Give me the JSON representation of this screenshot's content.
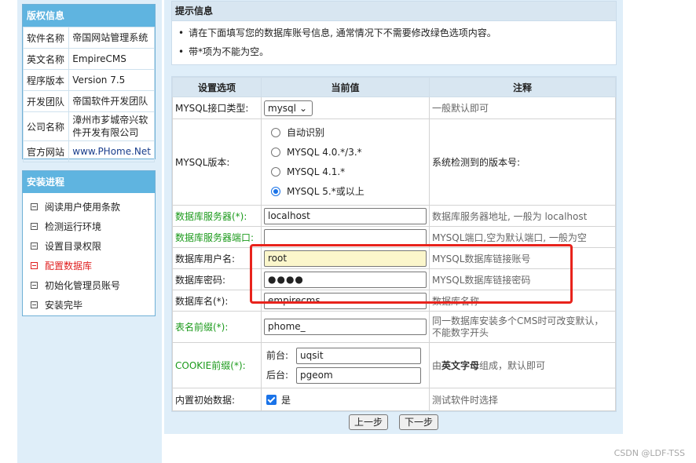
{
  "copyright": {
    "title": "版权信息",
    "rows": [
      {
        "key": "软件名称",
        "value": "帝国网站管理系统"
      },
      {
        "key": "英文名称",
        "value": "EmpireCMS"
      },
      {
        "key": "程序版本",
        "value": "Version 7.5"
      },
      {
        "key": "开发团队",
        "value": "帝国软件开发团队"
      },
      {
        "key": "公司名称",
        "value": "漳州市芗城帝兴软件开发有限公司"
      },
      {
        "key": "官方网站",
        "value": "www.PHome.Net"
      }
    ]
  },
  "progress": {
    "title": "安装进程",
    "steps": [
      "阅读用户使用条款",
      "检测运行环境",
      "设置目录权限",
      "配置数据库",
      "初始化管理员账号",
      "安装完毕"
    ],
    "active_index": 3
  },
  "tips": {
    "title": "提示信息",
    "items": [
      "请在下面填写您的数据库账号信息, 通常情况下不需要修改绿色选项内容。",
      "带*项为不能为空。"
    ]
  },
  "config": {
    "headers": [
      "设置选项",
      "当前值",
      "注释"
    ],
    "mysql_type": {
      "label": "MYSQL接口类型:",
      "value": "mysql",
      "note": "一般默认即可"
    },
    "mysql_version": {
      "label": "MYSQL版本:",
      "options": [
        "自动识别",
        "MYSQL 4.0.*/3.*",
        "MYSQL 4.1.*",
        "MYSQL 5.*或以上"
      ],
      "selected": 3,
      "note": "系统检测到的版本号:"
    },
    "db_server": {
      "label": "数据库服务器(*):",
      "value": "localhost",
      "note": "数据库服务器地址, 一般为 localhost"
    },
    "db_port": {
      "label": "数据库服务器端口:",
      "value": "",
      "note": "MYSQL端口,空为默认端口, 一般为空"
    },
    "db_user": {
      "label": "数据库用户名:",
      "value": "root",
      "note": "MYSQL数据库链接账号"
    },
    "db_pass": {
      "label": "数据库密码:",
      "value": "●●●●",
      "note": "MYSQL数据库链接密码"
    },
    "db_name": {
      "label": "数据库名(*):",
      "value": "empirecms",
      "note": "数据库名称"
    },
    "table_prefix": {
      "label": "表名前缀(*):",
      "value": "phome_",
      "note": "同一数据库安装多个CMS时可改变默认，不能数字开头"
    },
    "cookie_prefix": {
      "label": "COOKIE前缀(*):",
      "front_label": "前台:",
      "front_value": "uqsit",
      "back_label": "后台:",
      "back_value": "pgeom",
      "note_pre": "由",
      "note_bold": "英文字母",
      "note_post": "组成，默认即可"
    },
    "builtin_data": {
      "label": "内置初始数据:",
      "checked": true,
      "value": "是",
      "note": "测试软件时选择"
    }
  },
  "buttons": {
    "prev": "上一步",
    "next": "下一步"
  },
  "watermark": "CSDN @LDF-TSS",
  "colors": {
    "header_blue": "#5fb4e0",
    "green_label": "#1b9a1b",
    "highlight_red": "#e8231c",
    "active_step": "#e02020"
  }
}
